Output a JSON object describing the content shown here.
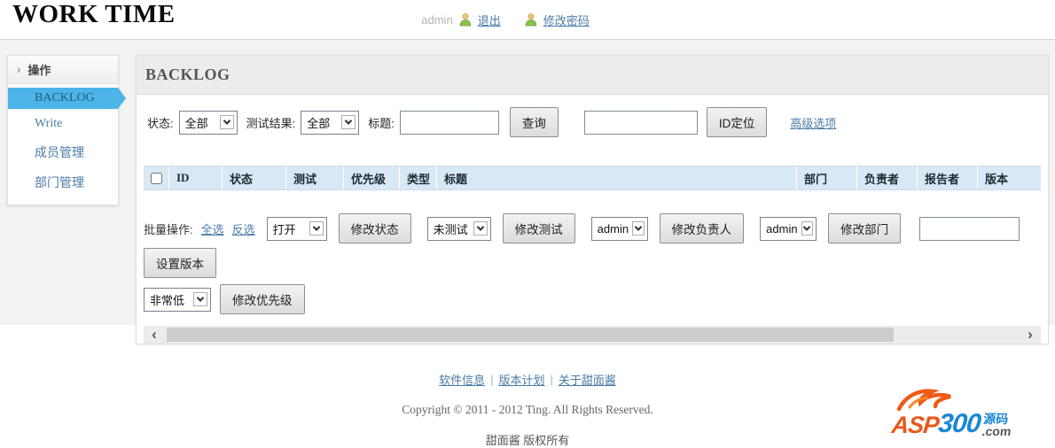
{
  "header": {
    "title": "WORK TIME",
    "username": "admin",
    "logout_label": "退出",
    "change_password_label": "修改密码"
  },
  "sidebar": {
    "section_title": "操作",
    "items": [
      {
        "label": "BACKLOG",
        "active": true
      },
      {
        "label": "Write",
        "active": false
      },
      {
        "label": "成员管理",
        "active": false
      },
      {
        "label": "部门管理",
        "active": false
      }
    ]
  },
  "main": {
    "title": "BACKLOG",
    "filters": {
      "status_label": "状态:",
      "status_value": "全部",
      "test_result_label": "测试结果:",
      "test_result_value": "全部",
      "title_label": "标题:",
      "title_input_value": "",
      "search_button": "查询",
      "id_input_value": "",
      "id_locate_button": "ID定位",
      "advanced_link": "高级选项"
    },
    "table": {
      "columns": [
        "ID",
        "状态",
        "测试",
        "优先级",
        "类型",
        "标题",
        "部门",
        "负责者",
        "报告者",
        "版本"
      ]
    },
    "batch": {
      "label": "批量操作:",
      "select_all_link": "全选",
      "invert_link": "反选",
      "status_select": "打开",
      "change_status_button": "修改状态",
      "test_select": "未测试",
      "change_test_button": "修改测试",
      "owner_select": "admin",
      "change_owner_button": "修改负责人",
      "dept_select": "admin",
      "change_dept_button": "修改部门",
      "version_input_value": "",
      "set_version_button": "设置版本",
      "priority_select": "非常低",
      "change_priority_button": "修改优先级"
    }
  },
  "footer": {
    "links": [
      "软件信息",
      "版本计划",
      "关于甜面酱"
    ],
    "separator": "|",
    "copyright": "Copyright © 2011 - 2012 Ting. All Rights Reserved.",
    "rights": "甜面酱 版权所有"
  },
  "watermark": {
    "asp": "ASP",
    "num": "300",
    "cn": "源码",
    "com": ".com"
  },
  "icons": {
    "chevron_right": "›",
    "scroll_left": "‹",
    "scroll_right": "›"
  },
  "colors": {
    "accent_blue": "#4cb4e7",
    "link_blue": "#4a7ba6",
    "table_header_bg": "#d9e8f5",
    "panel_bg": "#f2f2f2",
    "watermark_orange": "#e8581c",
    "watermark_blue": "#1b87d6"
  }
}
